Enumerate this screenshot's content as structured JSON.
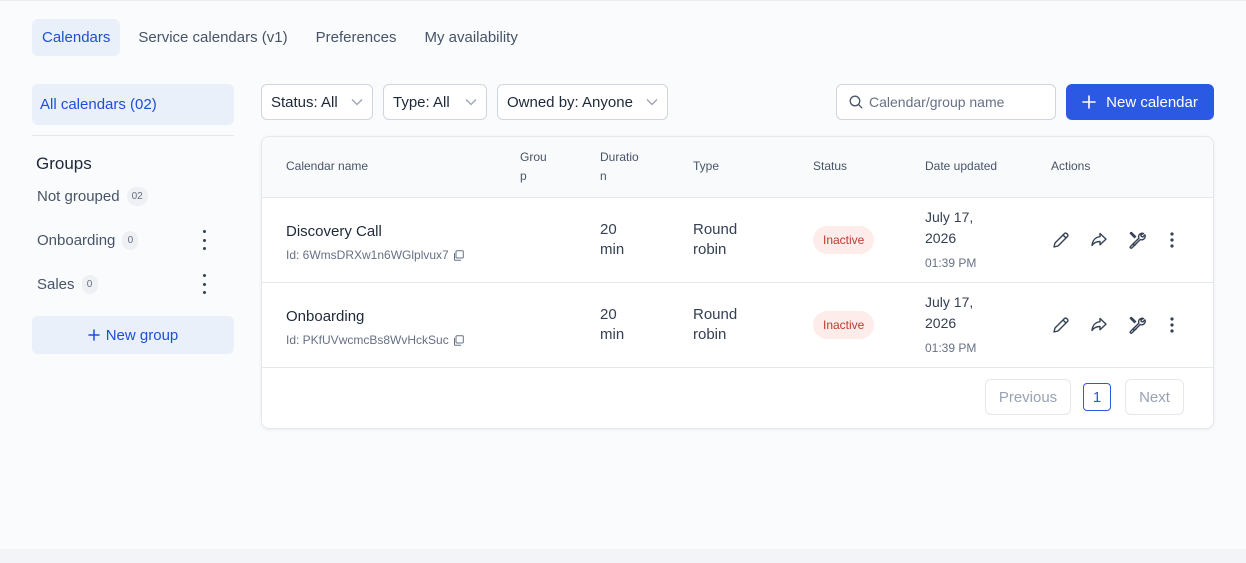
{
  "tabs": [
    {
      "label": "Calendars",
      "active": true
    },
    {
      "label": "Service calendars (v1)",
      "active": false
    },
    {
      "label": "Preferences",
      "active": false
    },
    {
      "label": "My availability",
      "active": false
    }
  ],
  "sidebar": {
    "all_calendars": "All calendars (02)",
    "groups_title": "Groups",
    "groups": [
      {
        "label": "Not grouped",
        "count": "02"
      },
      {
        "label": "Onboarding",
        "count": "0"
      },
      {
        "label": "Sales",
        "count": "0"
      }
    ],
    "new_group": "New group"
  },
  "filters": {
    "status": "Status: All",
    "type": "Type: All",
    "owned_by": "Owned by: Anyone"
  },
  "search": {
    "placeholder": "Calendar/group name"
  },
  "new_calendar": "New calendar",
  "table": {
    "headers": {
      "name": "Calendar name",
      "group_1": "Grou",
      "group_2": "p",
      "duration_1": "Duratio",
      "duration_2": "n",
      "type": "Type",
      "status": "Status",
      "date": "Date updated",
      "actions": "Actions"
    },
    "rows": [
      {
        "name": "Discovery Call",
        "id": "Id: 6WmsDRXw1n6WGlplvux7",
        "duration_1": "20",
        "duration_2": "min",
        "type_1": "Round",
        "type_2": "robin",
        "status": "Inactive",
        "date_1": "July 17,",
        "date_2": "2026",
        "time": "01:39 PM"
      },
      {
        "name": "Onboarding",
        "id": "Id: PKfUVwcmcBs8WvHckSuc",
        "duration_1": "20",
        "duration_2": "min",
        "type_1": "Round",
        "type_2": "robin",
        "status": "Inactive",
        "date_1": "July 17,",
        "date_2": "2026",
        "time": "01:39 PM"
      }
    ]
  },
  "pagination": {
    "previous": "Previous",
    "page": "1",
    "next": "Next"
  },
  "colors": {
    "accent": "#2b59e3",
    "inactive_bg": "#fdecea",
    "inactive_text": "#c0392b"
  }
}
